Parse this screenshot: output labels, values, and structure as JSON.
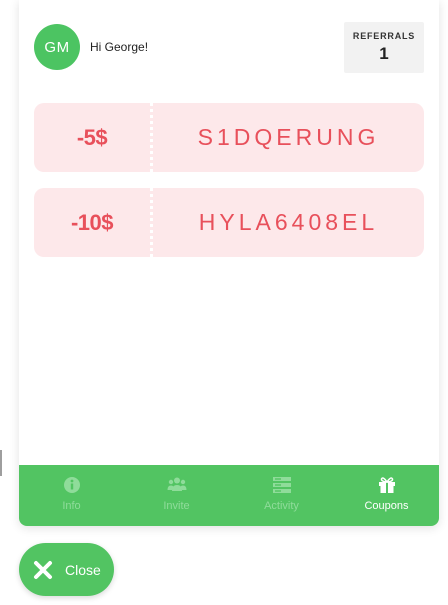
{
  "header": {
    "avatar_initials": "GM",
    "greeting": "Hi George!",
    "referrals": {
      "label": "REFERRALS",
      "count": "1"
    }
  },
  "coupons": [
    {
      "amount": "-5$",
      "code": "S1DQERUNG"
    },
    {
      "amount": "-10$",
      "code": "HYLA6408EL"
    }
  ],
  "nav": {
    "items": [
      {
        "label": "Info",
        "icon": "info-icon",
        "active": false
      },
      {
        "label": "Invite",
        "icon": "group-icon",
        "active": false
      },
      {
        "label": "Activity",
        "icon": "list-icon",
        "active": false
      },
      {
        "label": "Coupons",
        "icon": "gift-icon",
        "active": true
      }
    ]
  },
  "close_button": {
    "label": "Close",
    "icon": "close-icon"
  },
  "colors": {
    "brand_green": "#52c462",
    "coupon_bg": "#fde8ea",
    "coupon_text": "#e8505b",
    "nav_inactive": "#8fdc9a"
  }
}
